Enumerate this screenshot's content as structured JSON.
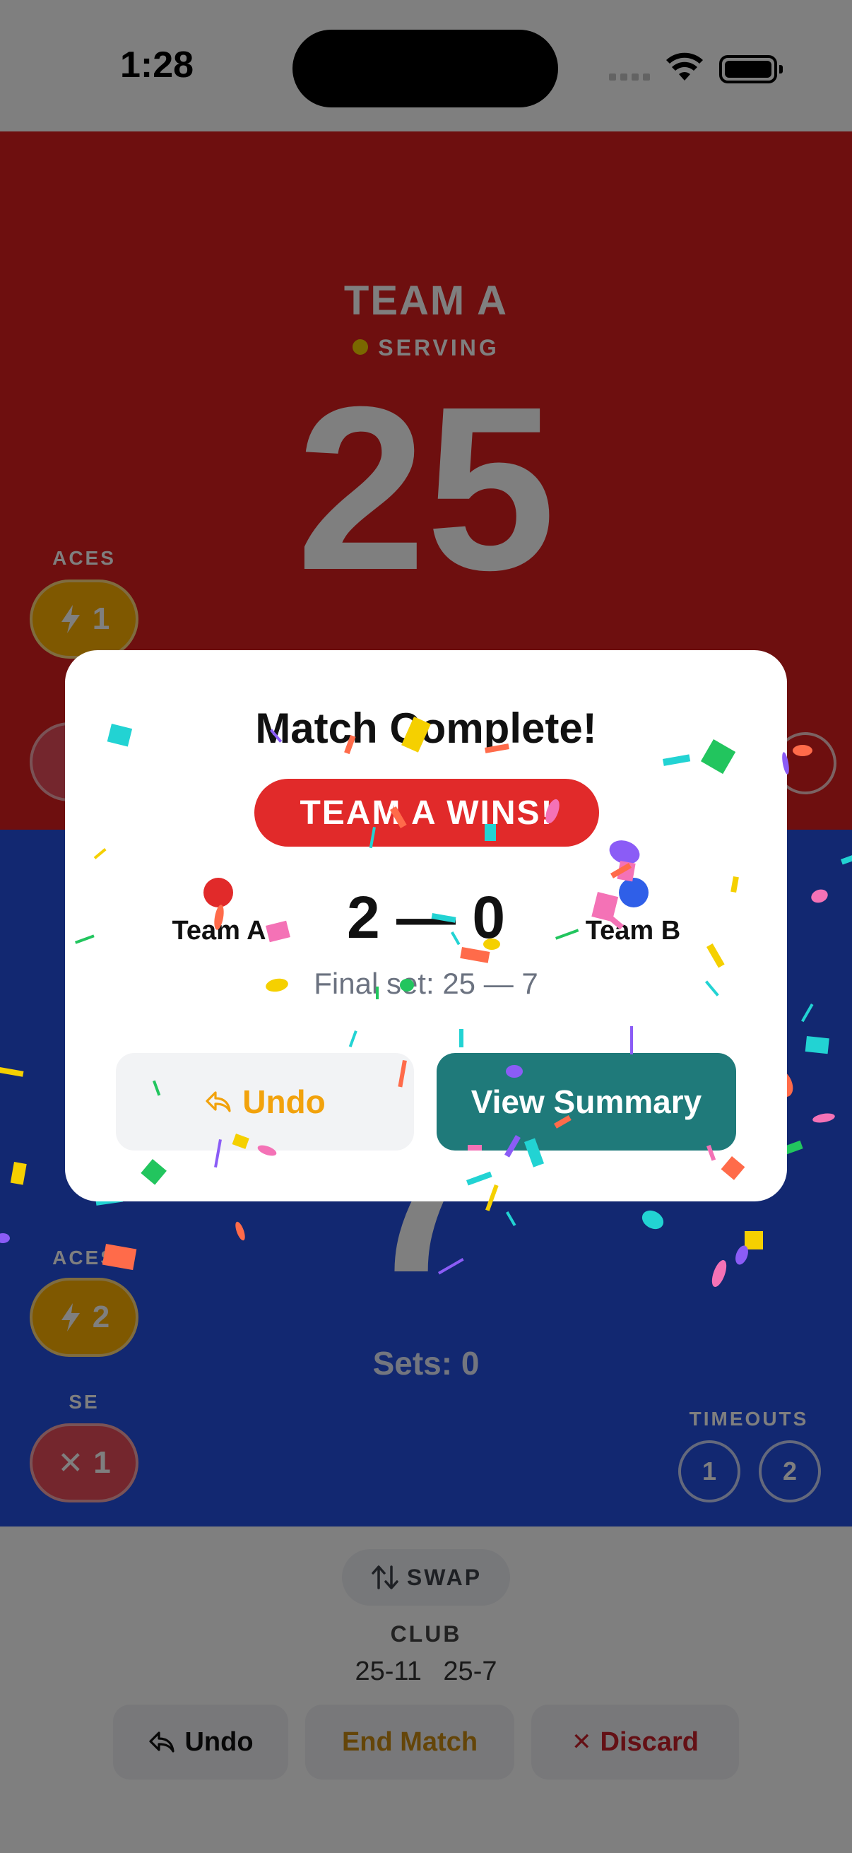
{
  "status_bar": {
    "time": "1:28"
  },
  "team_a": {
    "name": "TEAM A",
    "serving_label": "SERVING",
    "score": "25",
    "aces_label": "ACES",
    "aces_count": "1",
    "color": "#dc1e1e"
  },
  "team_b": {
    "score": "7",
    "aces_label": "ACES",
    "aces_count": "2",
    "se_label": "SE",
    "se_count": "1",
    "sets_text": "Sets: 0",
    "timeouts_label": "TIMEOUTS",
    "timeout_1": "1",
    "timeout_2": "2",
    "color": "#2550e2"
  },
  "bottom": {
    "swap_label": "SWAP",
    "club_label": "CLUB",
    "set_scores": "25-11   25-7",
    "undo_label": "Undo",
    "end_match_label": "End Match",
    "discard_label": "Discard"
  },
  "modal": {
    "title": "Match Complete!",
    "winner_badge": "TEAM A WINS!",
    "team_left": "Team A",
    "team_right": "Team B",
    "match_score": "2 — 0",
    "final_set": "Final set: 25 — 7",
    "undo_label": "Undo",
    "view_summary_label": "View Summary"
  },
  "colors": {
    "team_a_dot": "#e12a2a",
    "team_b_dot": "#2f5fe8",
    "accent_teal": "#1f7a7a",
    "undo_orange": "#f2a20c",
    "discard_red": "#c8202a",
    "end_match_orange": "#c98a12"
  },
  "icons": {
    "undo": "arrow-uturn-left-icon",
    "swap": "arrows-up-down-icon",
    "ace": "bolt-icon",
    "error": "x-icon"
  }
}
